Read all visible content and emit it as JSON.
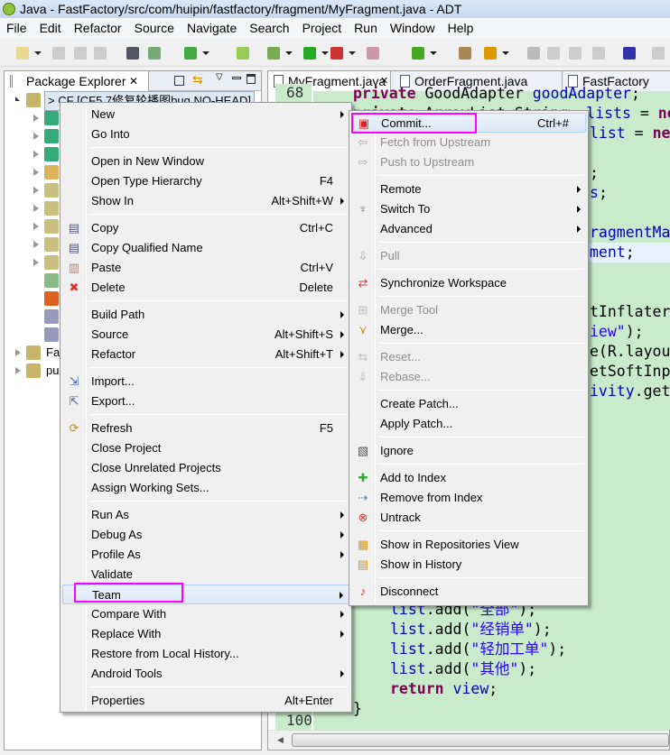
{
  "window": {
    "title": "Java - FastFactory/src/com/huipin/fastfactory/fragment/MyFragment.java - ADT"
  },
  "menubar": [
    "File",
    "Edit",
    "Refactor",
    "Source",
    "Navigate",
    "Search",
    "Project",
    "Run",
    "Window",
    "Help"
  ],
  "explorer": {
    "tab": "Package Explorer",
    "project_label": "> CF [CF5 7修复轮播图bug NO-HEAD]",
    "rows": [
      "Fas",
      "pu"
    ]
  },
  "editor": {
    "tabs": [
      "MyFragment.java",
      "OrderFragment.java",
      "FastFactory Mani"
    ],
    "line_numbers": {
      "first": "68",
      "last": "100"
    },
    "code": {
      "l68a": "private",
      "l68b": " GoodAdapter ",
      "l68c": "goodAdapter",
      "l68d": ";",
      "l69a": "private",
      "l69b": " ArrayList<String> ",
      "l69c": "lists",
      "l69d": " = ",
      "l69e": "ne",
      "l70c": "list",
      "l70e": "new",
      "l72": ";",
      "l73a": "s",
      "l75": "ragmentMan",
      "l76a": "ment",
      "l79": "tInflater",
      "l80a": "iew\"",
      "l80b": ");",
      "l81": "e(R.layout",
      "l82": "etSoftInpu",
      "l83a": "ivity",
      "l83b": ".getS",
      "l93a": "list",
      "l93b": ".add(",
      "l93c": "\"全部\"",
      "l94c": "\"经销单\"",
      "l95c": "\"轻加工单\"",
      "l96c": "\"其他\"",
      "ret": "return",
      "view": " view",
      "close": "}"
    }
  },
  "context_menu": [
    {
      "label": "New",
      "arrow": true
    },
    {
      "label": "Go Into"
    },
    {
      "sep": true
    },
    {
      "label": "Open in New Window"
    },
    {
      "label": "Open Type Hierarchy",
      "shortcut": "F4"
    },
    {
      "label": "Show In",
      "shortcut": "Alt+Shift+W",
      "arrow": true
    },
    {
      "sep": true
    },
    {
      "label": "Copy",
      "shortcut": "Ctrl+C",
      "icon": "copy-icon"
    },
    {
      "label": "Copy Qualified Name",
      "icon": "copy-qualified-icon"
    },
    {
      "label": "Paste",
      "shortcut": "Ctrl+V",
      "icon": "paste-icon"
    },
    {
      "label": "Delete",
      "shortcut": "Delete",
      "icon": "delete-icon"
    },
    {
      "sep": true
    },
    {
      "label": "Build Path",
      "arrow": true
    },
    {
      "label": "Source",
      "shortcut": "Alt+Shift+S",
      "arrow": true
    },
    {
      "label": "Refactor",
      "shortcut": "Alt+Shift+T",
      "arrow": true
    },
    {
      "sep": true
    },
    {
      "label": "Import...",
      "icon": "import-icon"
    },
    {
      "label": "Export...",
      "icon": "export-icon"
    },
    {
      "sep": true
    },
    {
      "label": "Refresh",
      "shortcut": "F5",
      "icon": "refresh-icon"
    },
    {
      "label": "Close Project"
    },
    {
      "label": "Close Unrelated Projects"
    },
    {
      "label": "Assign Working Sets..."
    },
    {
      "sep": true
    },
    {
      "label": "Run As",
      "arrow": true
    },
    {
      "label": "Debug As",
      "arrow": true
    },
    {
      "label": "Profile As",
      "arrow": true
    },
    {
      "label": "Validate"
    },
    {
      "label": "Team",
      "arrow": true,
      "active": true
    },
    {
      "label": "Compare With",
      "arrow": true
    },
    {
      "label": "Replace With",
      "arrow": true
    },
    {
      "label": "Restore from Local History..."
    },
    {
      "label": "Android Tools",
      "arrow": true
    },
    {
      "sep": true
    },
    {
      "label": "Properties",
      "shortcut": "Alt+Enter"
    }
  ],
  "team_menu": [
    {
      "label": "Commit...",
      "shortcut": "Ctrl+#",
      "icon": "commit-icon",
      "active": true
    },
    {
      "label": "Fetch from Upstream",
      "disabled": true,
      "icon": "fetch-icon"
    },
    {
      "label": "Push to Upstream",
      "disabled": true,
      "icon": "push-icon"
    },
    {
      "sep": true
    },
    {
      "label": "Remote",
      "arrow": true
    },
    {
      "label": "Switch To",
      "arrow": true,
      "icon": "switch-icon"
    },
    {
      "label": "Advanced",
      "arrow": true
    },
    {
      "sep": true
    },
    {
      "label": "Pull",
      "disabled": true,
      "icon": "pull-icon"
    },
    {
      "sep": true
    },
    {
      "label": "Synchronize Workspace",
      "icon": "synchronize-icon"
    },
    {
      "sep": true
    },
    {
      "label": "Merge Tool",
      "disabled": true,
      "icon": "merge-tool-icon"
    },
    {
      "label": "Merge...",
      "icon": "merge-icon"
    },
    {
      "sep": true
    },
    {
      "label": "Reset...",
      "disabled": true,
      "icon": "reset-icon"
    },
    {
      "label": "Rebase...",
      "disabled": true,
      "icon": "rebase-icon"
    },
    {
      "sep": true
    },
    {
      "label": "Create Patch..."
    },
    {
      "label": "Apply Patch..."
    },
    {
      "sep": true
    },
    {
      "label": "Ignore",
      "icon": "ignore-icon"
    },
    {
      "sep": true
    },
    {
      "label": "Add to Index",
      "icon": "add-icon"
    },
    {
      "label": "Remove from Index",
      "icon": "remove-index-icon"
    },
    {
      "label": "Untrack",
      "icon": "untrack-icon"
    },
    {
      "sep": true
    },
    {
      "label": "Show in Repositories View",
      "icon": "repositories-icon"
    },
    {
      "label": "Show in History",
      "icon": "history-icon"
    },
    {
      "sep": true
    },
    {
      "label": "Disconnect",
      "icon": "disconnect-icon"
    }
  ],
  "colors": {
    "highlight_box": "#ff00ff",
    "code_bg": "#c7ebcb",
    "keyword": "#7f0055",
    "string": "#2a00ff"
  }
}
